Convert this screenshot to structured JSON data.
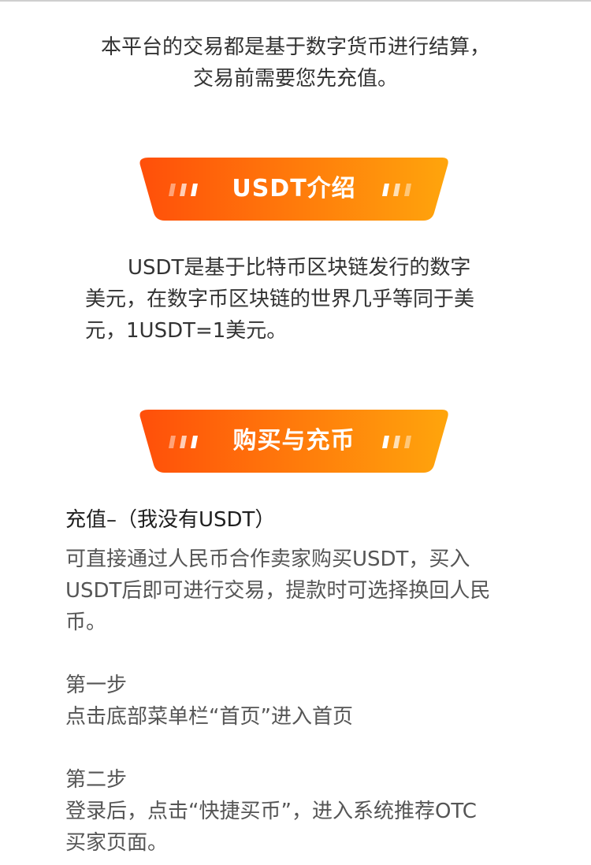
{
  "intro": {
    "line1": "本平台的交易都是基于数字货币进行结算，",
    "line2": "交易前需要您先充值。"
  },
  "banners": {
    "usdt_intro": "USDT介绍",
    "buy_coin": "购买与充币"
  },
  "usdt_description": {
    "line1": "USDT是基于比特币区块链发行的数字",
    "line2": "美元，在数字币区块链的世界几乎等同于美",
    "line3": "元，1USDT=1美元。"
  },
  "recharge": {
    "title": "充值–（我没有USDT）",
    "line1": "可直接通过人民币合作卖家购买USDT，买入",
    "line2": "USDT后即可进行交易，提款时可选择换回人民",
    "line3": "币。"
  },
  "step1": {
    "title": "第一步",
    "text": "点击底部菜单栏“首页”进入首页"
  },
  "step2": {
    "title": "第二步",
    "line1": "登录后，点击“快捷买币”，进入系统推荐OTC",
    "line2": "买家页面。"
  },
  "colors": {
    "banner_start": "#ff4f0a",
    "banner_end": "#ffa50c",
    "text_primary": "#333333",
    "text_secondary": "#555555"
  }
}
